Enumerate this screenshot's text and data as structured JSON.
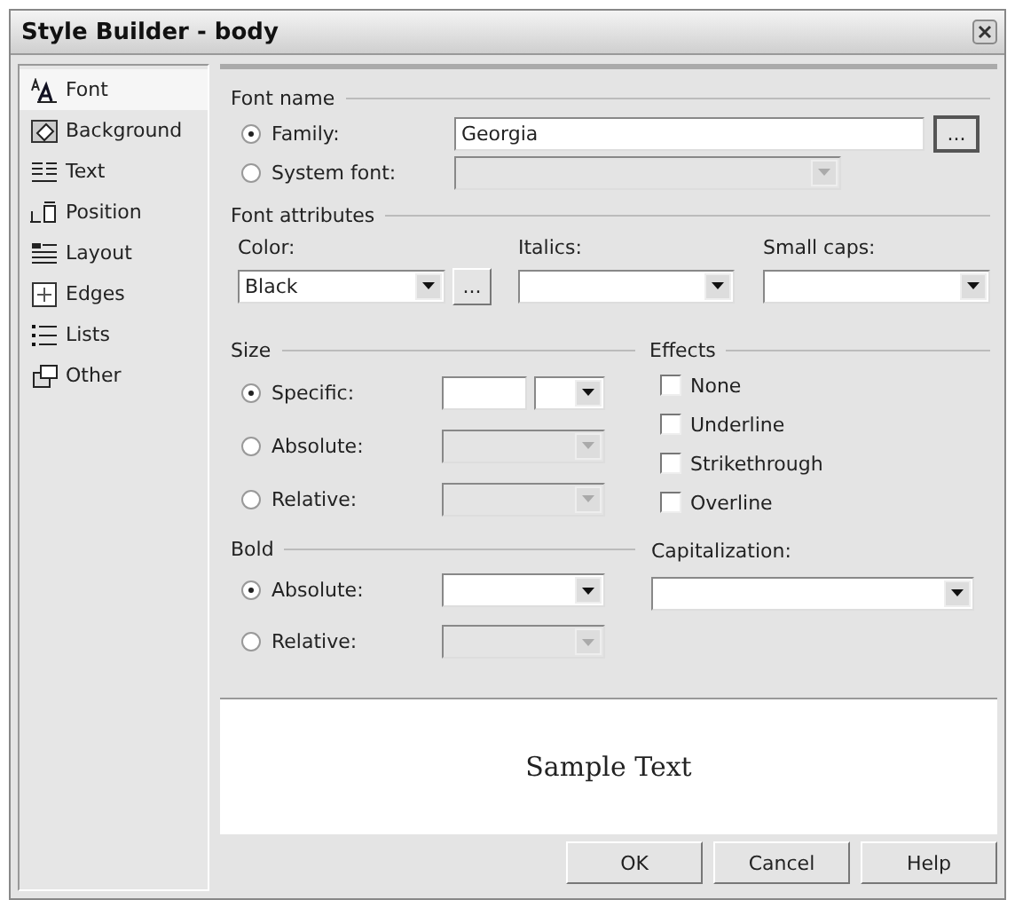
{
  "window": {
    "title": "Style Builder - body"
  },
  "sidebar": {
    "items": [
      {
        "label": "Font",
        "kind": "font",
        "selected": true
      },
      {
        "label": "Background",
        "kind": "background",
        "selected": false
      },
      {
        "label": "Text",
        "kind": "text",
        "selected": false
      },
      {
        "label": "Position",
        "kind": "position",
        "selected": false
      },
      {
        "label": "Layout",
        "kind": "layout",
        "selected": false
      },
      {
        "label": "Edges",
        "kind": "edges",
        "selected": false
      },
      {
        "label": "Lists",
        "kind": "lists",
        "selected": false
      },
      {
        "label": "Other",
        "kind": "other",
        "selected": false
      }
    ]
  },
  "font_name": {
    "heading": "Font name",
    "options": [
      {
        "label": "Family:",
        "selected": true,
        "field": {
          "kind": "text",
          "value": "Georgia",
          "disabled": false
        },
        "browse": "..."
      },
      {
        "label": "System font:",
        "selected": false,
        "field": {
          "kind": "select",
          "disabled": true
        }
      }
    ]
  },
  "font_attributes": {
    "heading": "Font attributes",
    "color": {
      "label": "Color:",
      "value": "Black",
      "browse": "..."
    },
    "italics": {
      "label": "Italics:"
    },
    "small_caps": {
      "label": "Small caps:"
    }
  },
  "size": {
    "heading": "Size",
    "options": [
      {
        "label": "Specific:",
        "selected": true,
        "disabled": false,
        "unit": true
      },
      {
        "label": "Absolute:",
        "selected": false,
        "disabled": true,
        "unit": false
      },
      {
        "label": "Relative:",
        "selected": false,
        "disabled": true,
        "unit": false
      }
    ]
  },
  "bold": {
    "heading": "Bold",
    "options": [
      {
        "label": "Absolute:",
        "selected": true,
        "disabled": false
      },
      {
        "label": "Relative:",
        "selected": false,
        "disabled": true
      }
    ]
  },
  "effects": {
    "heading": "Effects",
    "items": [
      {
        "label": "None",
        "checked": false
      },
      {
        "label": "Underline",
        "checked": false
      },
      {
        "label": "Strikethrough",
        "checked": false
      },
      {
        "label": "Overline",
        "checked": false
      }
    ]
  },
  "capitalization": {
    "label": "Capitalization:"
  },
  "preview": {
    "text": "Sample Text"
  },
  "buttons": [
    "OK",
    "Cancel",
    "Help"
  ]
}
